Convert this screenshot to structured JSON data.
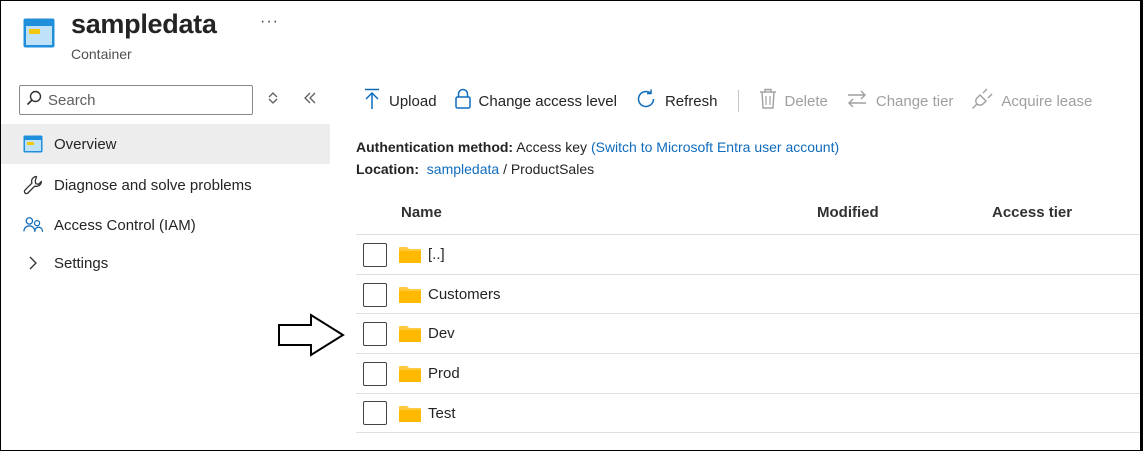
{
  "header": {
    "title": "sampledata",
    "subtitle": "Container",
    "more": "···"
  },
  "sidebar": {
    "search_placeholder": "Search",
    "items": [
      {
        "label": "Overview",
        "icon": "container-icon",
        "active": true
      },
      {
        "label": "Diagnose and solve problems",
        "icon": "wrench-icon"
      },
      {
        "label": "Access Control (IAM)",
        "icon": "people-icon"
      },
      {
        "label": "Settings",
        "icon": "chevron-right-icon"
      }
    ]
  },
  "toolbar": {
    "upload": "Upload",
    "change_access": "Change access level",
    "refresh": "Refresh",
    "delete": "Delete",
    "change_tier": "Change tier",
    "acquire_lease": "Acquire lease"
  },
  "info": {
    "auth_label": "Authentication method:",
    "auth_value": "Access key",
    "auth_link": "(Switch to Microsoft Entra user account)",
    "location_label": "Location:",
    "location_link": "sampledata",
    "location_sep": "/",
    "location_path": "ProductSales"
  },
  "table": {
    "columns": [
      "Name",
      "Modified",
      "Access tier"
    ],
    "rows": [
      {
        "name": "[..]"
      },
      {
        "name": "Customers"
      },
      {
        "name": "Dev"
      },
      {
        "name": "Prod"
      },
      {
        "name": "Test"
      }
    ]
  },
  "colors": {
    "accent": "#0f6cbd",
    "folder": "#ffc83d",
    "active_bg": "#ededed"
  }
}
